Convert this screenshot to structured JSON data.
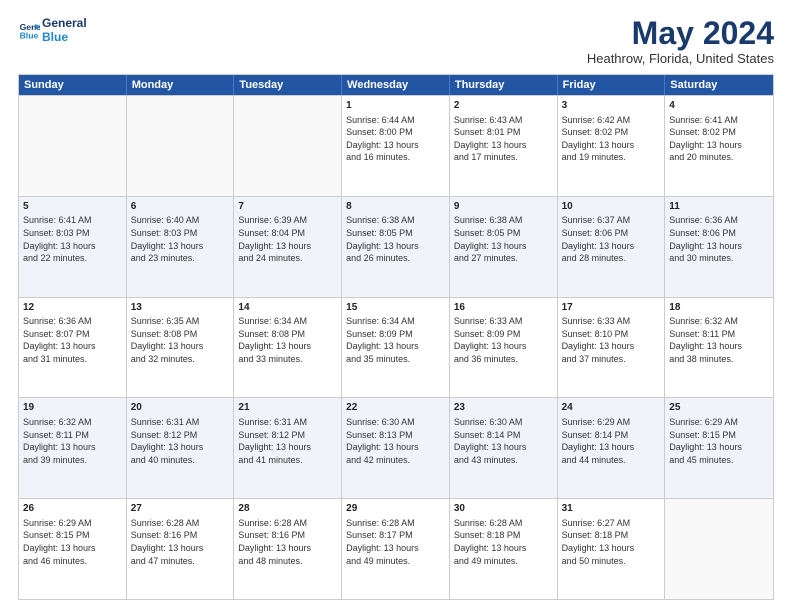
{
  "logo": {
    "line1": "General",
    "line2": "Blue"
  },
  "title": "May 2024",
  "subtitle": "Heathrow, Florida, United States",
  "dayHeaders": [
    "Sunday",
    "Monday",
    "Tuesday",
    "Wednesday",
    "Thursday",
    "Friday",
    "Saturday"
  ],
  "weeks": [
    [
      {
        "date": "",
        "info": ""
      },
      {
        "date": "",
        "info": ""
      },
      {
        "date": "",
        "info": ""
      },
      {
        "date": "1",
        "info": "Sunrise: 6:44 AM\nSunset: 8:00 PM\nDaylight: 13 hours\nand 16 minutes."
      },
      {
        "date": "2",
        "info": "Sunrise: 6:43 AM\nSunset: 8:01 PM\nDaylight: 13 hours\nand 17 minutes."
      },
      {
        "date": "3",
        "info": "Sunrise: 6:42 AM\nSunset: 8:02 PM\nDaylight: 13 hours\nand 19 minutes."
      },
      {
        "date": "4",
        "info": "Sunrise: 6:41 AM\nSunset: 8:02 PM\nDaylight: 13 hours\nand 20 minutes."
      }
    ],
    [
      {
        "date": "5",
        "info": "Sunrise: 6:41 AM\nSunset: 8:03 PM\nDaylight: 13 hours\nand 22 minutes."
      },
      {
        "date": "6",
        "info": "Sunrise: 6:40 AM\nSunset: 8:03 PM\nDaylight: 13 hours\nand 23 minutes."
      },
      {
        "date": "7",
        "info": "Sunrise: 6:39 AM\nSunset: 8:04 PM\nDaylight: 13 hours\nand 24 minutes."
      },
      {
        "date": "8",
        "info": "Sunrise: 6:38 AM\nSunset: 8:05 PM\nDaylight: 13 hours\nand 26 minutes."
      },
      {
        "date": "9",
        "info": "Sunrise: 6:38 AM\nSunset: 8:05 PM\nDaylight: 13 hours\nand 27 minutes."
      },
      {
        "date": "10",
        "info": "Sunrise: 6:37 AM\nSunset: 8:06 PM\nDaylight: 13 hours\nand 28 minutes."
      },
      {
        "date": "11",
        "info": "Sunrise: 6:36 AM\nSunset: 8:06 PM\nDaylight: 13 hours\nand 30 minutes."
      }
    ],
    [
      {
        "date": "12",
        "info": "Sunrise: 6:36 AM\nSunset: 8:07 PM\nDaylight: 13 hours\nand 31 minutes."
      },
      {
        "date": "13",
        "info": "Sunrise: 6:35 AM\nSunset: 8:08 PM\nDaylight: 13 hours\nand 32 minutes."
      },
      {
        "date": "14",
        "info": "Sunrise: 6:34 AM\nSunset: 8:08 PM\nDaylight: 13 hours\nand 33 minutes."
      },
      {
        "date": "15",
        "info": "Sunrise: 6:34 AM\nSunset: 8:09 PM\nDaylight: 13 hours\nand 35 minutes."
      },
      {
        "date": "16",
        "info": "Sunrise: 6:33 AM\nSunset: 8:09 PM\nDaylight: 13 hours\nand 36 minutes."
      },
      {
        "date": "17",
        "info": "Sunrise: 6:33 AM\nSunset: 8:10 PM\nDaylight: 13 hours\nand 37 minutes."
      },
      {
        "date": "18",
        "info": "Sunrise: 6:32 AM\nSunset: 8:11 PM\nDaylight: 13 hours\nand 38 minutes."
      }
    ],
    [
      {
        "date": "19",
        "info": "Sunrise: 6:32 AM\nSunset: 8:11 PM\nDaylight: 13 hours\nand 39 minutes."
      },
      {
        "date": "20",
        "info": "Sunrise: 6:31 AM\nSunset: 8:12 PM\nDaylight: 13 hours\nand 40 minutes."
      },
      {
        "date": "21",
        "info": "Sunrise: 6:31 AM\nSunset: 8:12 PM\nDaylight: 13 hours\nand 41 minutes."
      },
      {
        "date": "22",
        "info": "Sunrise: 6:30 AM\nSunset: 8:13 PM\nDaylight: 13 hours\nand 42 minutes."
      },
      {
        "date": "23",
        "info": "Sunrise: 6:30 AM\nSunset: 8:14 PM\nDaylight: 13 hours\nand 43 minutes."
      },
      {
        "date": "24",
        "info": "Sunrise: 6:29 AM\nSunset: 8:14 PM\nDaylight: 13 hours\nand 44 minutes."
      },
      {
        "date": "25",
        "info": "Sunrise: 6:29 AM\nSunset: 8:15 PM\nDaylight: 13 hours\nand 45 minutes."
      }
    ],
    [
      {
        "date": "26",
        "info": "Sunrise: 6:29 AM\nSunset: 8:15 PM\nDaylight: 13 hours\nand 46 minutes."
      },
      {
        "date": "27",
        "info": "Sunrise: 6:28 AM\nSunset: 8:16 PM\nDaylight: 13 hours\nand 47 minutes."
      },
      {
        "date": "28",
        "info": "Sunrise: 6:28 AM\nSunset: 8:16 PM\nDaylight: 13 hours\nand 48 minutes."
      },
      {
        "date": "29",
        "info": "Sunrise: 6:28 AM\nSunset: 8:17 PM\nDaylight: 13 hours\nand 49 minutes."
      },
      {
        "date": "30",
        "info": "Sunrise: 6:28 AM\nSunset: 8:18 PM\nDaylight: 13 hours\nand 49 minutes."
      },
      {
        "date": "31",
        "info": "Sunrise: 6:27 AM\nSunset: 8:18 PM\nDaylight: 13 hours\nand 50 minutes."
      },
      {
        "date": "",
        "info": ""
      }
    ]
  ]
}
